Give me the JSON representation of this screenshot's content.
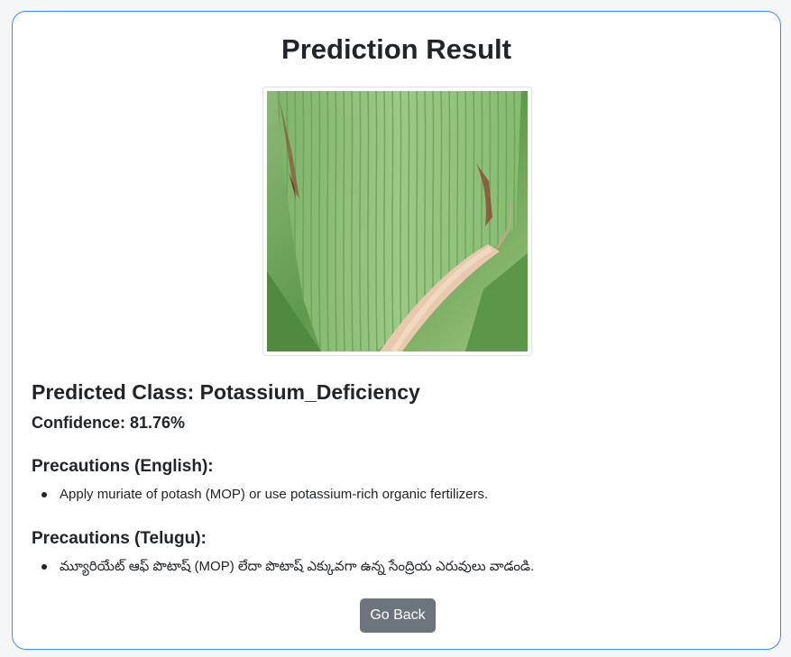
{
  "result": {
    "title": "Prediction Result",
    "image": {
      "alt": "Uploaded leaf image",
      "description_icon": "leaf-photo"
    },
    "predicted_class_label": "Predicted Class: Potassium_Deficiency",
    "confidence_label": "Confidence: 81.76%"
  },
  "precautions": {
    "english": {
      "heading": "Precautions (English):",
      "items": [
        "Apply muriate of potash (MOP) or use potassium-rich organic fertilizers."
      ]
    },
    "telugu": {
      "heading": "Precautions (Telugu):",
      "items": [
        "మ్యూరియేట్ ఆఫ్ పొటాష్ (MOP) లేదా పొటాష్ ఎక్కువగా ఉన్న సేంద్రియ ఎరువులు వాడండి."
      ]
    }
  },
  "actions": {
    "back_label": "Go Back"
  },
  "colors": {
    "card_border": "#3d8bfd",
    "button_bg": "#6c757d",
    "text": "#212529"
  }
}
